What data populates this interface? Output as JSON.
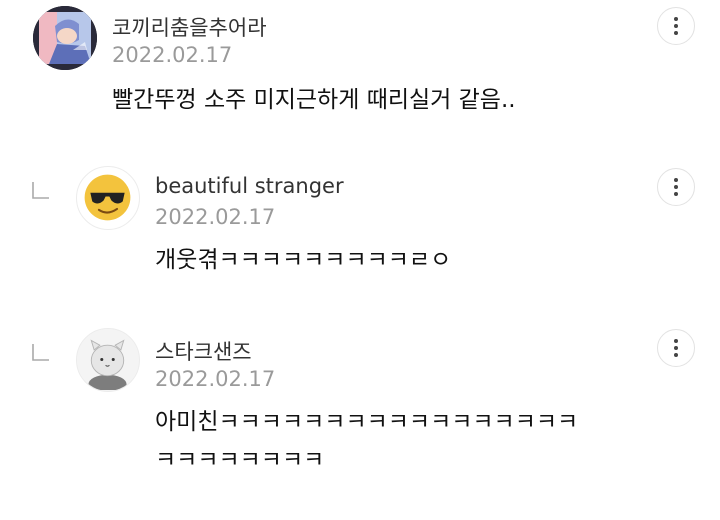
{
  "comments": [
    {
      "username": "코끼리춤을추어라",
      "date": "2022.02.17",
      "text": "빨간뚜껑 소주 미지근하게 때리실거 같음..",
      "avatar_icon": "anime-character-avatar"
    },
    {
      "username": "beautiful stranger",
      "date": "2022.02.17",
      "text": "개웃겪ㅋㅋㅋㅋㅋㅋㅋㅋㅋㄹㅇ",
      "avatar_icon": "sunglasses-emoji-avatar",
      "is_reply": true
    },
    {
      "username": "스타크샌즈",
      "date": "2022.02.17",
      "text_line1": "아미친ㅋㅋㅋㅋㅋㅋㅋㅋㅋㅋㅋㅋㅋㅋㅋㅋㅋ",
      "text_line2": "ㅋㅋㅋㅋㅋㅋㅋㅋ",
      "avatar_icon": "bear-avatar",
      "is_reply": true
    }
  ],
  "colors": {
    "username": "#333333",
    "date": "#9a9a9a",
    "text": "#111111",
    "button_border": "#e2e2e2"
  },
  "icons": {
    "more": "more-vertical-icon",
    "reply": "reply-arrow-icon"
  }
}
